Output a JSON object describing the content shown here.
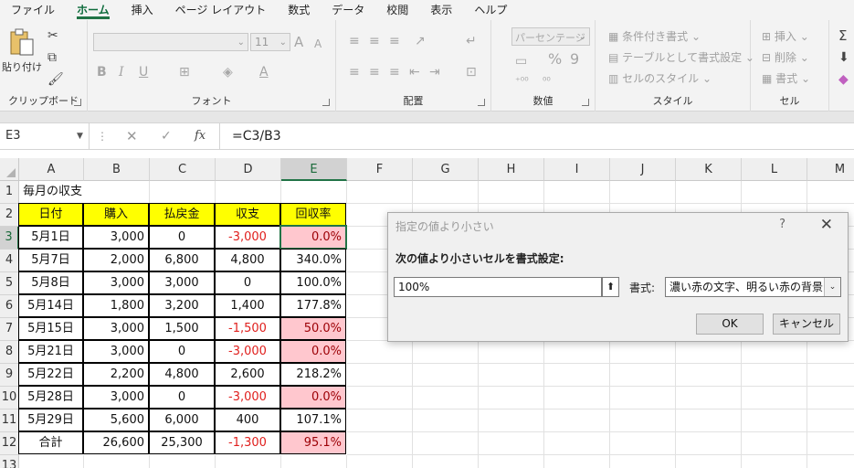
{
  "menu": {
    "tabs": [
      "ファイル",
      "ホーム",
      "挿入",
      "ページ レイアウト",
      "数式",
      "データ",
      "校閲",
      "表示",
      "ヘルプ"
    ],
    "active": "ホーム"
  },
  "ribbon": {
    "clipboard": {
      "label": "クリップボード",
      "paste_label": "貼り付け"
    },
    "font": {
      "label": "フォント",
      "size": "11",
      "bold": "B",
      "italic": "I",
      "underline": "U",
      "grow": "A",
      "shrink": "A"
    },
    "alignment": {
      "label": "配置"
    },
    "number": {
      "label": "数値",
      "format": "パーセンテージ"
    },
    "styles": {
      "label": "スタイル",
      "conditional": "条件付き書式",
      "table": "テーブルとして書式設定",
      "cell_styles": "セルのスタイル"
    },
    "cells": {
      "label": "セル",
      "insert": "挿入",
      "delete": "削除",
      "format": "書式"
    }
  },
  "formula_bar": {
    "name_box": "E3",
    "formula": "=C3/B3",
    "fx": "fx"
  },
  "grid": {
    "columns": [
      "A",
      "B",
      "C",
      "D",
      "E",
      "F",
      "G",
      "H",
      "I",
      "J",
      "K",
      "L",
      "M"
    ],
    "rows": [
      "1",
      "2",
      "3",
      "4",
      "5",
      "6",
      "7",
      "8",
      "9",
      "10",
      "11",
      "12",
      "13"
    ],
    "title": "毎月の収支",
    "headers": [
      "日付",
      "購入",
      "払戻金",
      "収支",
      "回収率"
    ],
    "data": [
      [
        "5月1日",
        "3,000",
        "0",
        "-3,000",
        "0.0%"
      ],
      [
        "5月7日",
        "2,000",
        "6,800",
        "4,800",
        "340.0%"
      ],
      [
        "5月8日",
        "3,000",
        "3,000",
        "0",
        "100.0%"
      ],
      [
        "5月14日",
        "1,800",
        "3,200",
        "1,400",
        "177.8%"
      ],
      [
        "5月15日",
        "3,000",
        "1,500",
        "-1,500",
        "50.0%"
      ],
      [
        "5月21日",
        "3,000",
        "0",
        "-3,000",
        "0.0%"
      ],
      [
        "5月22日",
        "2,200",
        "4,800",
        "2,600",
        "218.2%"
      ],
      [
        "5月28日",
        "3,000",
        "0",
        "-3,000",
        "0.0%"
      ],
      [
        "5月29日",
        "5,600",
        "6,000",
        "400",
        "107.1%"
      ],
      [
        "合計",
        "26,600",
        "25,300",
        "-1,300",
        "95.1%"
      ]
    ]
  },
  "dialog": {
    "title": "指定の値より小さい",
    "help": "?",
    "close": "✕",
    "prompt": "次の値より小さいセルを書式設定:",
    "value": "100%",
    "format_label": "書式:",
    "format_value": "濃い赤の文字、明るい赤の背景",
    "ok": "OK",
    "cancel": "キャンセル"
  },
  "colors": {
    "accent": "#217346",
    "highlight_fill": "#ffc7ce",
    "highlight_text": "#9c0006",
    "header_fill": "#ffff00",
    "negative": "#e0201e"
  }
}
